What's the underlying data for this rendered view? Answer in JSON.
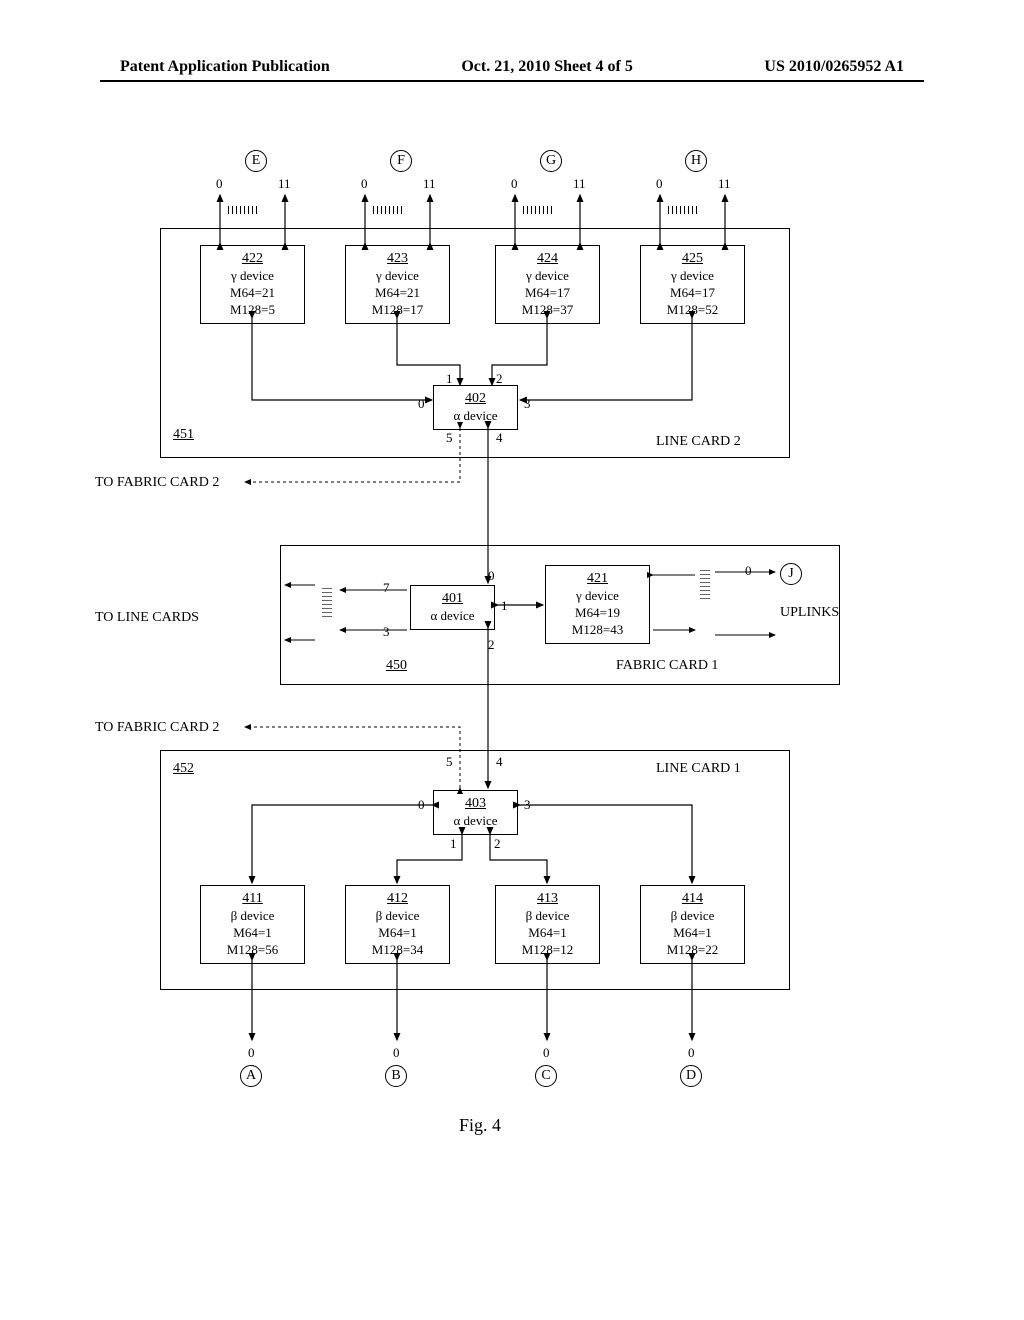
{
  "header": {
    "left": "Patent Application Publication",
    "center": "Oct. 21, 2010   Sheet 4 of 5",
    "right": "US 2010/0265952 A1"
  },
  "endpoints_top": [
    "E",
    "F",
    "G",
    "H"
  ],
  "endpoints_bottom": [
    "A",
    "B",
    "C",
    "D"
  ],
  "endpoint_j": "J",
  "port_pair": {
    "low": "0",
    "high": "11"
  },
  "port_single": "0",
  "alpha_ports": {
    "p0": "0",
    "p1": "1",
    "p2": "2",
    "p3": "3",
    "p4": "4",
    "p5": "5",
    "p7": "7"
  },
  "devices": {
    "d422": {
      "ref": "422",
      "type": "γ device",
      "m64": "M64=21",
      "m128": "M128=5"
    },
    "d423": {
      "ref": "423",
      "type": "γ device",
      "m64": "M64=21",
      "m128": "M128=17"
    },
    "d424": {
      "ref": "424",
      "type": "γ device",
      "m64": "M64=17",
      "m128": "M128=37"
    },
    "d425": {
      "ref": "425",
      "type": "γ device",
      "m64": "M64=17",
      "m128": "M128=52"
    },
    "d402": {
      "ref": "402",
      "type": "α device"
    },
    "d401": {
      "ref": "401",
      "type": "α device"
    },
    "d421": {
      "ref": "421",
      "type": "γ device",
      "m64": "M64=19",
      "m128": "M128=43"
    },
    "d403": {
      "ref": "403",
      "type": "α device"
    },
    "d411": {
      "ref": "411",
      "type": "β device",
      "m64": "M64=1",
      "m128": "M128=56"
    },
    "d412": {
      "ref": "412",
      "type": "β device",
      "m64": "M64=1",
      "m128": "M128=34"
    },
    "d413": {
      "ref": "413",
      "type": "β device",
      "m64": "M64=1",
      "m128": "M128=12"
    },
    "d414": {
      "ref": "414",
      "type": "β device",
      "m64": "M64=1",
      "m128": "M128=22"
    }
  },
  "cards": {
    "c451": {
      "ref": "451",
      "label": "LINE CARD 2"
    },
    "c450": {
      "ref": "450",
      "label": "FABRIC CARD 1"
    },
    "c452": {
      "ref": "452",
      "label": "LINE CARD 1"
    }
  },
  "labels": {
    "to_fabric_2": "TO FABRIC CARD 2",
    "to_line_cards": "TO LINE CARDS",
    "uplinks": "UPLINKS"
  },
  "figcaption": "Fig. 4",
  "chart_data": {
    "type": "table",
    "title": "Device register values (M64, M128)",
    "rows": [
      {
        "device": "411",
        "type": "β",
        "M64": 1,
        "M128": 56
      },
      {
        "device": "412",
        "type": "β",
        "M64": 1,
        "M128": 34
      },
      {
        "device": "413",
        "type": "β",
        "M64": 1,
        "M128": 12
      },
      {
        "device": "414",
        "type": "β",
        "M64": 1,
        "M128": 22
      },
      {
        "device": "421",
        "type": "γ",
        "M64": 19,
        "M128": 43
      },
      {
        "device": "422",
        "type": "γ",
        "M64": 21,
        "M128": 5
      },
      {
        "device": "423",
        "type": "γ",
        "M64": 21,
        "M128": 17
      },
      {
        "device": "424",
        "type": "γ",
        "M64": 17,
        "M128": 37
      },
      {
        "device": "425",
        "type": "γ",
        "M64": 17,
        "M128": 52
      }
    ]
  }
}
